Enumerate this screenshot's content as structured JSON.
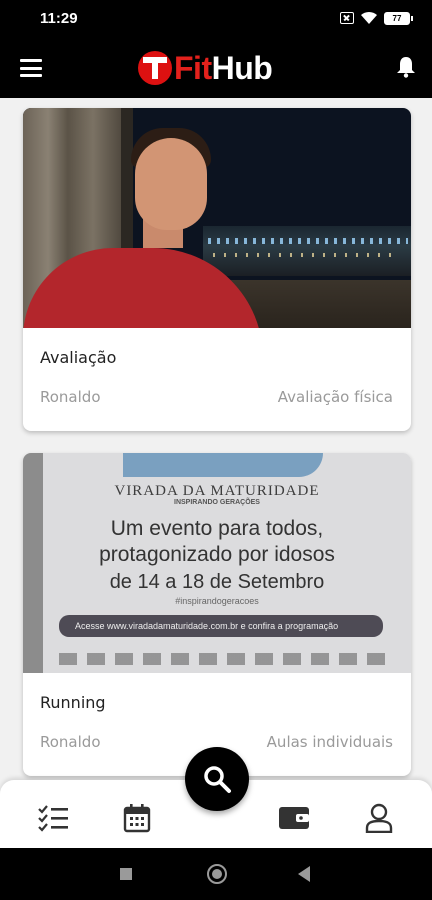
{
  "status_bar": {
    "time": "11:29",
    "battery": "77"
  },
  "header": {
    "logo_part1": "Fit",
    "logo_part2": "Hub",
    "brand_red": "#e3211c"
  },
  "feed": {
    "cards": [
      {
        "title": "Avaliação",
        "author": "Ronaldo",
        "category": "Avaliação física"
      },
      {
        "title": "Running",
        "author": "Ronaldo",
        "category": "Aulas individuais",
        "banner": {
          "line1": "VIRADA DA MATURIDADE",
          "line2": "INSPIRANDO GERAÇÕES",
          "line3": "Um evento para todos,",
          "line4": "protagonizado por idosos",
          "line5": "de 14 a 18 de Setembro",
          "hashtag": "#inspirandogeracoes",
          "bar_text": "Acesse www.viradadamaturidade.com.br e confira a programação"
        }
      }
    ]
  },
  "fab": {
    "icon": "search-icon"
  },
  "bottom_nav": {
    "items": [
      {
        "icon": "checklist-icon"
      },
      {
        "icon": "calendar-icon"
      },
      {
        "icon": "wallet-icon"
      },
      {
        "icon": "user-icon"
      }
    ]
  }
}
